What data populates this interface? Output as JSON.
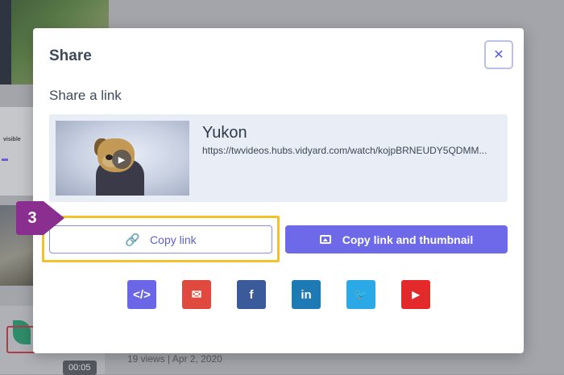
{
  "background": {
    "thumb_text": "visible",
    "duration": "00:05",
    "meta": "19 views  |  Apr 2, 2020"
  },
  "modal": {
    "title": "Share",
    "close_icon": "close-icon",
    "section_label": "Share a link",
    "video": {
      "title": "Yukon",
      "url": "https://twvideos.hubs.vidyard.com/watch/kojpBRNEUDY5QDMM..."
    },
    "copy_link_label": "Copy link",
    "copy_thumbnail_label": "Copy link and thumbnail",
    "social": [
      {
        "name": "embed",
        "glyph": "</>",
        "color": "#6b66e6"
      },
      {
        "name": "email",
        "glyph": "✉",
        "color": "#e0493d"
      },
      {
        "name": "facebook",
        "glyph": "f",
        "color": "#3b5a9a"
      },
      {
        "name": "linkedin",
        "glyph": "in",
        "color": "#1d7ab5"
      },
      {
        "name": "twitter",
        "glyph": "🐦",
        "color": "#2aa9e6"
      },
      {
        "name": "youtube",
        "glyph": "▶",
        "color": "#e4292b"
      }
    ]
  },
  "step_badge": "3",
  "colors": {
    "accent": "#6d69e9",
    "highlight": "#f2c22c",
    "badge": "#8a2f8f"
  }
}
